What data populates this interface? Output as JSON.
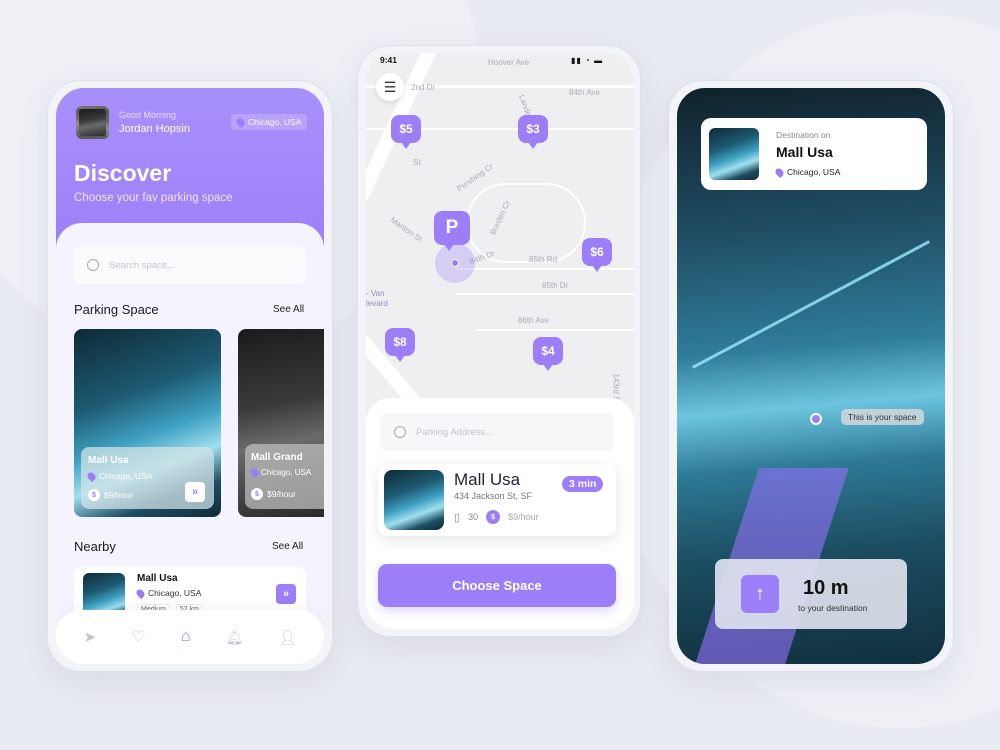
{
  "colors": {
    "accent": "#9b7ef8",
    "background": "#e9ebf2"
  },
  "discover": {
    "greeting": "Good Morning",
    "user_name": "Jordan Hopsin",
    "location": "Chicago, USA",
    "title": "Discover",
    "subtitle": "Choose your fav parking space",
    "search_placeholder": "Search space...",
    "parking_section": "Parking Space",
    "see_all": "See All",
    "cards": [
      {
        "name": "Mall Usa",
        "location": "Chicago, USA",
        "price": "$9/hour"
      },
      {
        "name": "Mall Grand",
        "location": "Chicago, USA",
        "price": "$9/hour"
      }
    ],
    "nearby_section": "Nearby",
    "nearby": [
      {
        "name": "Mall Usa",
        "location": "Chicago, USA",
        "tag1": "Medium",
        "tag2": "52 km"
      }
    ],
    "nav": [
      "send-icon",
      "heart-icon",
      "home-icon",
      "bell-icon",
      "user-icon"
    ]
  },
  "map": {
    "time": "9:41",
    "streets": [
      "Hoover Ave",
      "2nd Dr",
      "84th Ave",
      "Lande",
      "St",
      "Pershing Cr",
      "Burden Cr",
      "Manton St",
      "84th Dr",
      "85th Rd",
      "85th Dr",
      "86th Ave",
      "- Van",
      "levard",
      "143rd S"
    ],
    "markers": [
      "$5",
      "$3",
      "P",
      "$6",
      "$8",
      "$4"
    ],
    "search_placeholder": "Parking Address...",
    "result": {
      "name": "Mall Usa",
      "address": "434 Jackson St, SF",
      "eta": "3 min",
      "spots": "30",
      "price": "$9/hour"
    },
    "cta": "Choose Space"
  },
  "nav_screen": {
    "dest_label": "Destination on",
    "dest_name": "Mall Usa",
    "dest_location": "Chicago, USA",
    "space_label": "This is your space",
    "distance": "10 m",
    "distance_label": "to your destination"
  }
}
